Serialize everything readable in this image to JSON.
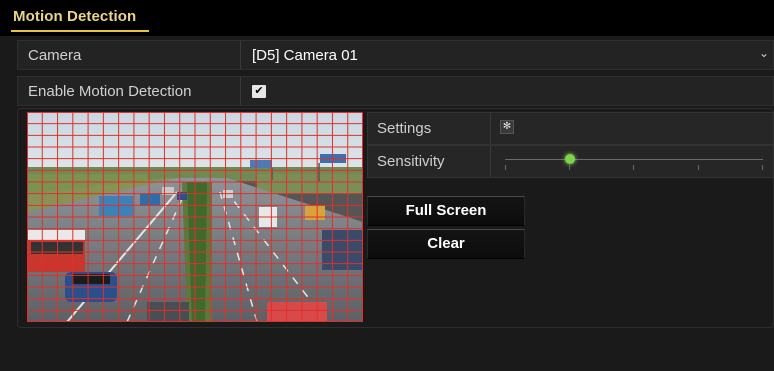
{
  "header": {
    "title": "Motion Detection"
  },
  "camera": {
    "label": "Camera",
    "value": "[D5] Camera 01"
  },
  "enable_motion": {
    "label": "Enable Motion Detection",
    "checked": true
  },
  "settings": {
    "label": "Settings"
  },
  "sensitivity": {
    "label": "Sensitivity",
    "level_fraction": 0.25
  },
  "buttons": {
    "full_screen": "Full Screen",
    "clear": "Clear"
  },
  "colors": {
    "accent": "#e8c43a",
    "grid": "#e0302a",
    "slider_knob": "#7ed34a"
  }
}
